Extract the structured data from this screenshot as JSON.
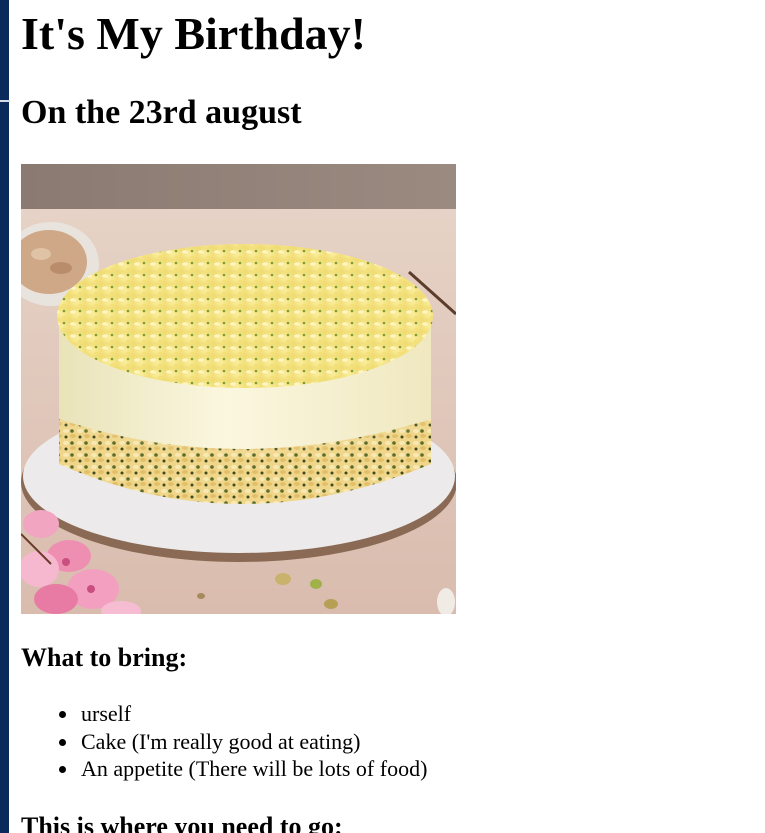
{
  "page": {
    "title": "It's My Birthday!",
    "subtitle": "On the 23rd august"
  },
  "image": {
    "subject": "cake-photo"
  },
  "bring": {
    "heading": "What to bring:",
    "items": [
      "urself",
      "Cake (I'm really good at eating)",
      "An appetite (There will be lots of food)"
    ]
  },
  "where": {
    "heading": "This is where you need to go:"
  },
  "colors": {
    "left_bar": "#0b2a5c",
    "text": "#000000",
    "background": "#ffffff"
  }
}
